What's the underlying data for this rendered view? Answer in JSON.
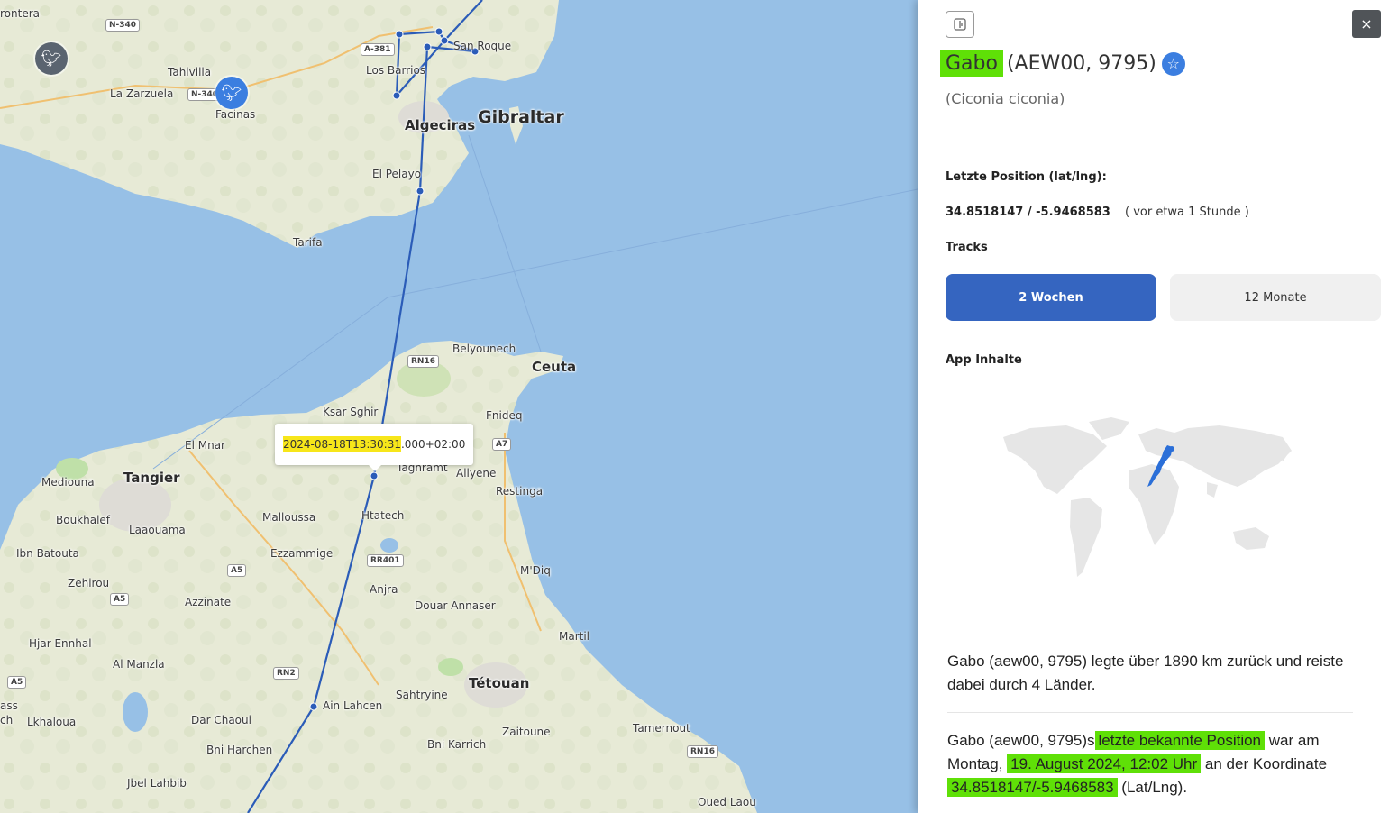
{
  "map": {
    "places": [
      {
        "id": "rontera",
        "label": "rontera",
        "cls": ""
      },
      {
        "id": "tahivilla",
        "label": "Tahivilla",
        "cls": ""
      },
      {
        "id": "lazarzuela",
        "label": "La Zarzuela",
        "cls": ""
      },
      {
        "id": "facinas",
        "label": "Facinas",
        "cls": ""
      },
      {
        "id": "losbarrios",
        "label": "Los Barrios",
        "cls": ""
      },
      {
        "id": "sanroque",
        "label": "San Roque",
        "cls": ""
      },
      {
        "id": "algeciras",
        "label": "Algeciras",
        "cls": "big"
      },
      {
        "id": "gibraltar",
        "label": "Gibraltar",
        "cls": "xl"
      },
      {
        "id": "elpelayo",
        "label": "El Pelayo",
        "cls": ""
      },
      {
        "id": "tarifa",
        "label": "Tarifa",
        "cls": ""
      },
      {
        "id": "belyounech",
        "label": "Belyounech",
        "cls": ""
      },
      {
        "id": "ceuta",
        "label": "Ceuta",
        "cls": "big"
      },
      {
        "id": "ksarsghir",
        "label": "Ksar Sghir",
        "cls": ""
      },
      {
        "id": "fnideq",
        "label": "Fnideq",
        "cls": ""
      },
      {
        "id": "elmnar",
        "label": "El Mnar",
        "cls": ""
      },
      {
        "id": "tangier",
        "label": "Tangier",
        "cls": "big"
      },
      {
        "id": "mediouna",
        "label": "Mediouna",
        "cls": ""
      },
      {
        "id": "taghramt",
        "label": "Taghramt",
        "cls": ""
      },
      {
        "id": "allyene",
        "label": "Allyene",
        "cls": ""
      },
      {
        "id": "restinga",
        "label": "Restinga",
        "cls": ""
      },
      {
        "id": "boukhalef",
        "label": "Boukhalef",
        "cls": ""
      },
      {
        "id": "laaouama",
        "label": "Laaouama",
        "cls": ""
      },
      {
        "id": "malloussa",
        "label": "Malloussa",
        "cls": ""
      },
      {
        "id": "htatech",
        "label": "Htatech",
        "cls": ""
      },
      {
        "id": "ibnbatouta",
        "label": "Ibn Batouta",
        "cls": ""
      },
      {
        "id": "ezzammige",
        "label": "Ezzammige",
        "cls": ""
      },
      {
        "id": "mdiq",
        "label": "M'Diq",
        "cls": ""
      },
      {
        "id": "zehirou",
        "label": "Zehirou",
        "cls": ""
      },
      {
        "id": "anjra",
        "label": "Anjra",
        "cls": ""
      },
      {
        "id": "azzinate",
        "label": "Azzinate",
        "cls": ""
      },
      {
        "id": "douarannaser",
        "label": "Douar Annaser",
        "cls": ""
      },
      {
        "id": "hjarennhal",
        "label": "Hjar Ennhal",
        "cls": ""
      },
      {
        "id": "martil",
        "label": "Martil",
        "cls": ""
      },
      {
        "id": "almanzla",
        "label": "Al Manzla",
        "cls": ""
      },
      {
        "id": "tetouan",
        "label": "Tétouan",
        "cls": "big"
      },
      {
        "id": "sahtryine",
        "label": "Sahtryine",
        "cls": ""
      },
      {
        "id": "ainlahcen",
        "label": "Ain Lahcen",
        "cls": ""
      },
      {
        "id": "ass",
        "label": "ass",
        "cls": ""
      },
      {
        "id": "lkhaloua",
        "label": "Lkhaloua",
        "cls": ""
      },
      {
        "id": "darchaoui",
        "label": "Dar Chaoui",
        "cls": ""
      },
      {
        "id": "zaitoune",
        "label": "Zaitoune",
        "cls": ""
      },
      {
        "id": "tamernout",
        "label": "Tamernout",
        "cls": ""
      },
      {
        "id": "bnikarrich",
        "label": "Bni Karrich",
        "cls": ""
      },
      {
        "id": "bniharchen",
        "label": "Bni Harchen",
        "cls": ""
      },
      {
        "id": "jbellahbib",
        "label": "Jbel Lahbib",
        "cls": ""
      },
      {
        "id": "ouedlaou",
        "label": "Oued Laou",
        "cls": ""
      },
      {
        "id": "ch",
        "label": "ch",
        "cls": ""
      }
    ],
    "roads": [
      "N-340",
      "A-381",
      "N-340",
      "RN16",
      "A7",
      "A5",
      "RR401",
      "A5",
      "RN2",
      "A5",
      "RN16"
    ],
    "tooltip_time": "2024-08-18T13:30:31",
    "tooltip_rest": ".000+02:00",
    "track_color": "#2b5cb8",
    "marker_gray": "#5a6470",
    "marker_blue": "#3b7ee0",
    "marker_icon": "stork-icon"
  },
  "panel": {
    "name": "Gabo",
    "ids": "(AEW00, 9795)",
    "latin": "(Ciconia ciconia)",
    "last_position_label": "Letzte Position (lat/lng):",
    "coords": "34.8518147 / -5.9468583",
    "ago": "( vor etwa 1 Stunde )",
    "tracks_label": "Tracks",
    "tab_2w": "2 Wochen",
    "tab_12m": "12 Monate",
    "app_label": "App Inhalte",
    "close": "×",
    "highlight_color": "#5fe007",
    "active_tab_color": "#3565c0",
    "desc1": "Gabo (aew00, 9795) legte über 1890 km zurück und reiste dabei durch 4 Länder.",
    "desc2_a": "Gabo (aew00, 9795)s",
    "desc2_b": "letzte bekannte Position",
    "desc2_c": "war am Montag,",
    "desc2_d": "19. August 2024, 12:02 Uhr",
    "desc2_e": "an der Koordinate",
    "desc2_f": "34.8518147/-5.9468583",
    "desc2_g": "(Lat/Lng)."
  }
}
